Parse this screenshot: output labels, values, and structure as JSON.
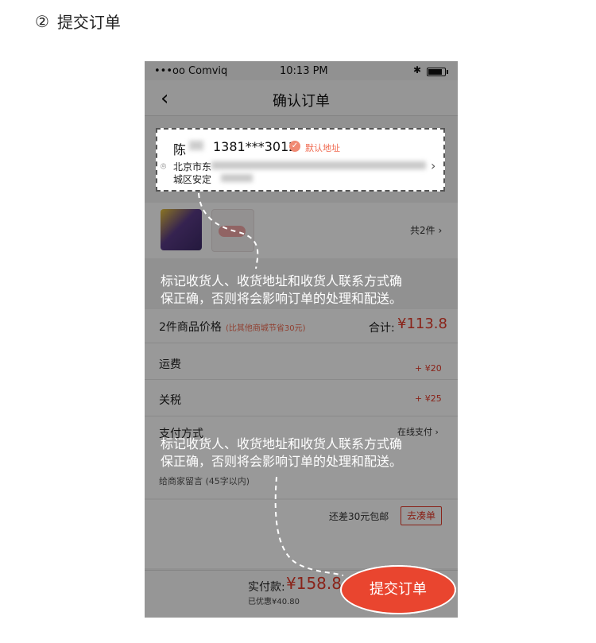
{
  "step": {
    "number": "②",
    "title": "提交订单"
  },
  "statusbar": {
    "carrier": "•••oo Comviq",
    "time": "10:13 PM",
    "bluetooth": "✱"
  },
  "navbar": {
    "back_icon": "chevron-left-icon",
    "title": "确认订单"
  },
  "address": {
    "name": "陈",
    "phone": "1381***3012",
    "default_label": "默认地址",
    "line1": "北京市东",
    "line2": "城区安定"
  },
  "goods": {
    "count_label": "共2件"
  },
  "price": {
    "label": "2件商品价格",
    "note": "(比其他商城节省30元)",
    "total_label": "合计:",
    "total_value": "¥113.8",
    "shipping_label": "运费",
    "shipping_value": "+ ¥20",
    "tax_label": "关税",
    "tax_value": "+ ¥25"
  },
  "payment": {
    "label": "支付方式",
    "value": "在线支付",
    "message_label": "给商家留言 (45字以内)"
  },
  "free_shipping": {
    "text": "还差30元包邮",
    "button": "去凑单"
  },
  "bottom": {
    "total_label": "实付款:",
    "total_value": "¥158.8",
    "discount": "已优惠¥40.80",
    "submit": "提交订单"
  },
  "tips": [
    {
      "line1": "标记收货人、收货地址和收货人联系方式确",
      "line2": "保正确，否则将会影响订单的处理和配送。"
    },
    {
      "line1": "标记收货人、收货地址和收货人联系方式确",
      "line2": "保正确，否则将会影响订单的处理和配送。"
    }
  ],
  "colors": {
    "accent": "#e53b2a",
    "overlay": "rgba(0,0,0,0.40)"
  }
}
